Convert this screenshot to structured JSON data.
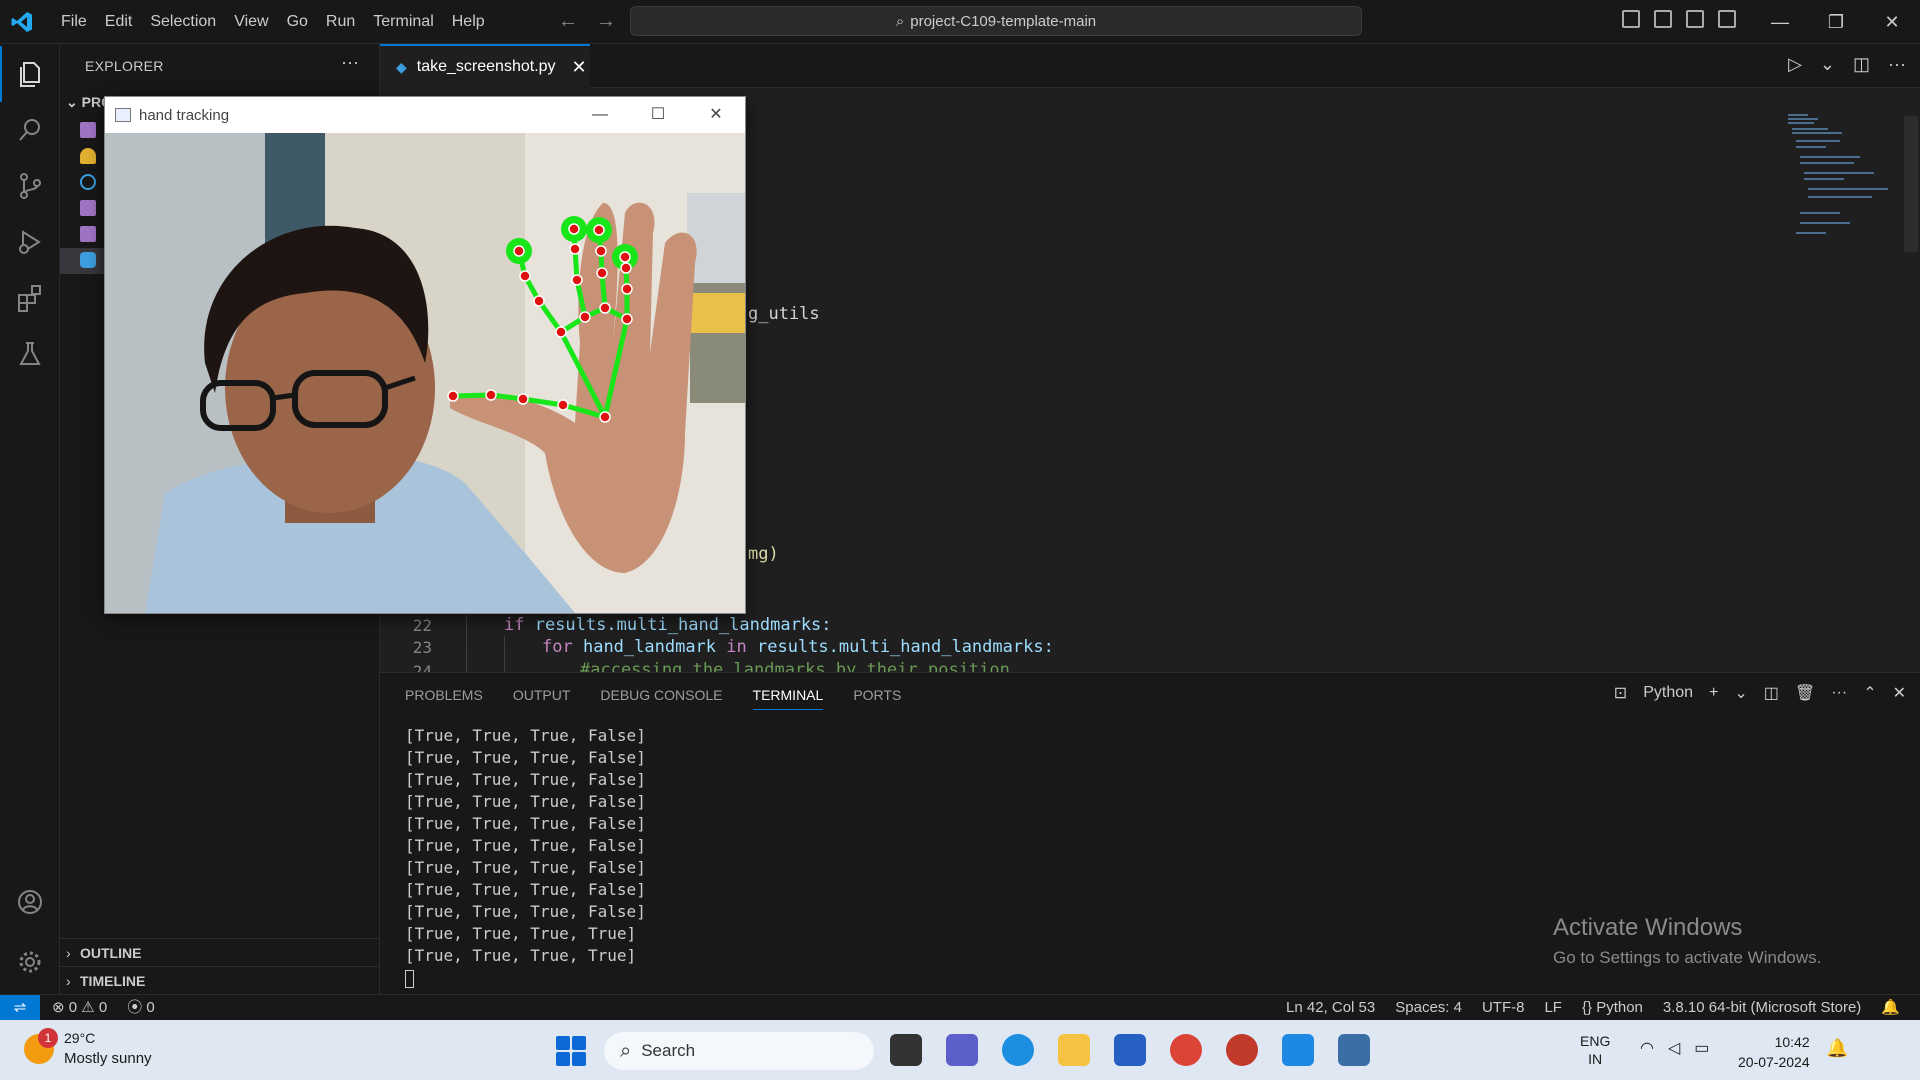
{
  "window": {
    "title": "project-C109-template-main",
    "menu": [
      "File",
      "Edit",
      "Selection",
      "View",
      "Go",
      "Run",
      "Terminal",
      "Help"
    ]
  },
  "sidebar": {
    "title": "EXPLORER",
    "project_label": "PRO",
    "sections": [
      "OUTLINE",
      "TIMELINE"
    ]
  },
  "editor": {
    "tab_label": "take_screenshot.py",
    "fragments": {
      "utils": "g_utils",
      "img": "mg)"
    },
    "lines": [
      {
        "num": "22",
        "kw": "if",
        "rest": " results.multi_hand_landmarks:"
      },
      {
        "num": "23",
        "kw": "for",
        "var1": "hand_landmark",
        "kw2": "in",
        "rest": " results.multi_hand_landmarks:"
      },
      {
        "num": "24",
        "comment": "#accessing the landmarks by their position"
      }
    ]
  },
  "panel": {
    "tabs": [
      "PROBLEMS",
      "OUTPUT",
      "DEBUG CONSOLE",
      "TERMINAL",
      "PORTS"
    ],
    "active_tab": "TERMINAL",
    "shell_label": "Python",
    "terminal_lines": [
      "[True, True, True, False]",
      "[True, True, True, False]",
      "[True, True, True, False]",
      "[True, True, True, False]",
      "[True, True, True, False]",
      "[True, True, True, False]",
      "[True, True, True, False]",
      "[True, True, True, False]",
      "[True, True, True, False]",
      "[True, True, True, True]",
      "[True, True, True, True]"
    ]
  },
  "watermark": {
    "line1": "Activate Windows",
    "line2": "Go to Settings to activate Windows."
  },
  "statusbar": {
    "errors": "0",
    "warnings": "0",
    "ports": "0",
    "position": "Ln 42, Col 53",
    "spaces": "Spaces: 4",
    "encoding": "UTF-8",
    "eol": "LF",
    "language": "Python",
    "interpreter": "3.8.10 64-bit (Microsoft Store)"
  },
  "floating_window": {
    "title": "hand tracking"
  },
  "taskbar": {
    "temperature": "29°C",
    "weather": "Mostly sunny",
    "weather_badge": "1",
    "search_label": "Search",
    "lang1": "ENG",
    "lang2": "IN",
    "time": "10:42",
    "date": "20-07-2024"
  }
}
